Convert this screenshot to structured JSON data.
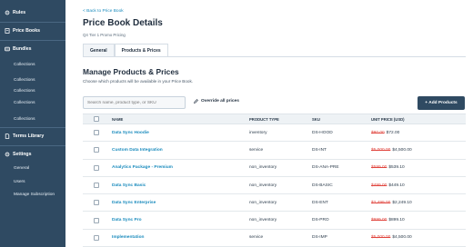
{
  "sidebar": {
    "sections": [
      {
        "label": "Rules",
        "icon": "gear-icon"
      },
      {
        "label": "Price Books",
        "icon": "book-icon"
      },
      {
        "label": "Bundles",
        "icon": "bundle-icon"
      },
      {
        "label": "Terms Library",
        "icon": "document-icon"
      },
      {
        "label": "Settings",
        "icon": "gear-icon"
      }
    ],
    "bundle_items": [
      "Collections",
      "Collections",
      "Collections",
      "Collections",
      "Collections"
    ],
    "settings_items": [
      "General",
      "Users",
      "Manage Subscription"
    ]
  },
  "header": {
    "back_link": "< Back to Price Book",
    "title": "Price Book Details",
    "subtitle": "Q4 Tier 1 Promo Pricing"
  },
  "tabs": [
    {
      "label": "General",
      "active": false
    },
    {
      "label": "Products & Prices",
      "active": true
    }
  ],
  "section": {
    "title": "Manage Products & Prices",
    "description": "Choose which products will be available in your Price Book."
  },
  "toolbar": {
    "search_placeholder": "Search name, product type, or SKU",
    "override_label": "Override all prices",
    "add_button": "+ Add Products"
  },
  "table": {
    "columns": [
      "NAME",
      "PRODUCT TYPE",
      "SKU",
      "UNIT PRICE (USD)"
    ],
    "rows": [
      {
        "name": "Data Sync Hoodie",
        "type": "inventory",
        "sku": "DS-HOOD",
        "old_price": "$80.00",
        "new_price": "$72.00"
      },
      {
        "name": "Custom Data Integration",
        "type": "service",
        "sku": "DS-INT",
        "old_price": "$5,000.00",
        "new_price": "$4,500.00"
      },
      {
        "name": "Analytics Package - Premium",
        "type": "non_inventory",
        "sku": "DS-ANA-PRE",
        "old_price": "$599.00",
        "new_price": "$539.10"
      },
      {
        "name": "Data Sync Basic",
        "type": "non_inventory",
        "sku": "DS-BASIC",
        "old_price": "$499.00",
        "new_price": "$449.10"
      },
      {
        "name": "Data Sync Enterprise",
        "type": "non_inventory",
        "sku": "DS-ENT",
        "old_price": "$2,499.00",
        "new_price": "$2,249.10"
      },
      {
        "name": "Data Sync Pro",
        "type": "non_inventory",
        "sku": "DS-PRO",
        "old_price": "$999.00",
        "new_price": "$899.10"
      },
      {
        "name": "Implementation",
        "type": "service",
        "sku": "DS-IMP",
        "old_price": "$5,000.00",
        "new_price": "$4,500.00"
      }
    ]
  },
  "colors": {
    "sidebar_bg": "#2f4a62",
    "link": "#1a8bbd",
    "strike_price": "#e0433c"
  }
}
